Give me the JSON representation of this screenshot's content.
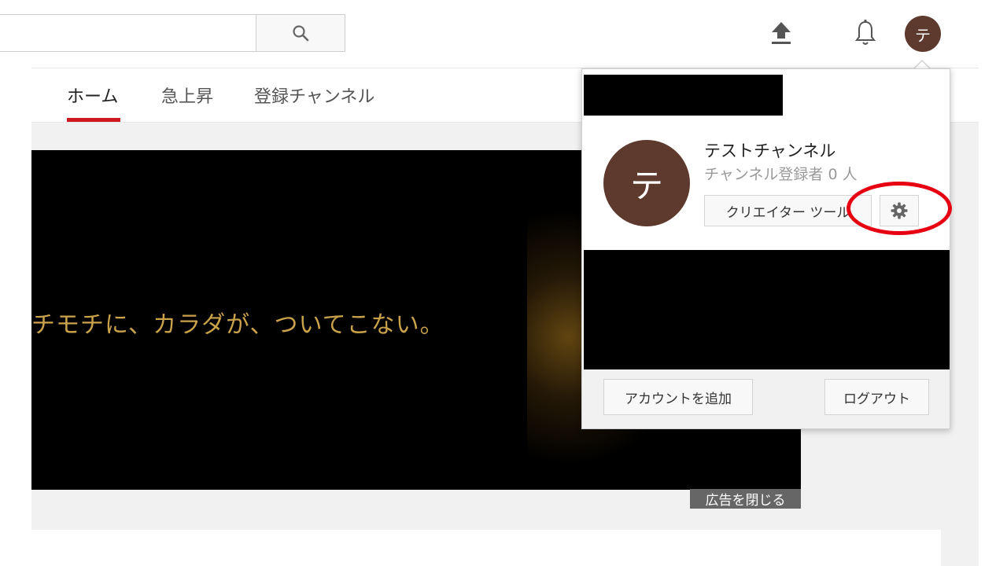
{
  "header": {
    "search_placeholder": "",
    "avatar_initial": "テ"
  },
  "tabs": [
    {
      "label": "ホーム",
      "active": true
    },
    {
      "label": "急上昇",
      "active": false
    },
    {
      "label": "登録チャンネル",
      "active": false
    }
  ],
  "ad": {
    "text": "チモチに、カラダが、ついてこない。",
    "close_label": "広告を閉じる"
  },
  "account_menu": {
    "avatar_initial": "テ",
    "channel_name": "テストチャンネル",
    "subscriber_text": "チャンネル登録者 0 人",
    "creator_tools_label": "クリエイター ツール",
    "add_account_label": "アカウントを追加",
    "logout_label": "ログアウト"
  },
  "colors": {
    "accent_red": "#cc181e",
    "highlight_red": "#e60012",
    "avatar_brown": "#5e3a2e"
  }
}
